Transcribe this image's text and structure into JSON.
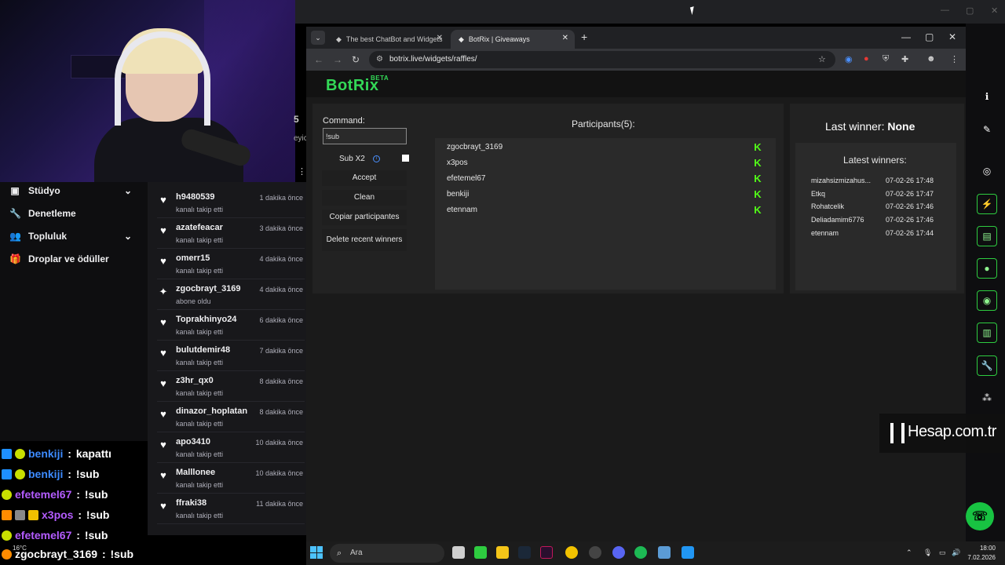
{
  "twitch_nav": {
    "items": [
      {
        "label": "Stüdyo",
        "icon": "studio-icon",
        "has_chevron": true
      },
      {
        "label": "Denetleme",
        "icon": "wrench-icon",
        "has_chevron": false
      },
      {
        "label": "Topluluk",
        "icon": "community-icon",
        "has_chevron": true
      },
      {
        "label": "Droplar ve ödüller",
        "icon": "gift-icon",
        "has_chevron": false
      }
    ]
  },
  "feed": {
    "partial_count": "5",
    "partial_text": "eyic",
    "rows": [
      {
        "name": "h9480539",
        "sub": "kanalı takip etti",
        "time": "1 dakika önce",
        "icon": "heart-icon"
      },
      {
        "name": "azatefeacar",
        "sub": "kanalı takip etti",
        "time": "3 dakika önce",
        "icon": "heart-icon"
      },
      {
        "name": "omerr15",
        "sub": "kanalı takip etti",
        "time": "4 dakika önce",
        "icon": "heart-icon"
      },
      {
        "name": "zgocbrayt_3169",
        "sub": "abone oldu",
        "time": "4 dakika önce",
        "icon": "sparkle-icon"
      },
      {
        "name": "Toprakhinyo24",
        "sub": "kanalı takip etti",
        "time": "6 dakika önce",
        "icon": "heart-icon"
      },
      {
        "name": "bulutdemir48",
        "sub": "kanalı takip etti",
        "time": "7 dakika önce",
        "icon": "heart-icon"
      },
      {
        "name": "z3hr_qx0",
        "sub": "kanalı takip etti",
        "time": "8 dakika önce",
        "icon": "heart-icon"
      },
      {
        "name": "dinazor_hoplatan",
        "sub": "kanalı takip etti",
        "time": "8 dakika önce",
        "icon": "heart-icon"
      },
      {
        "name": "apo3410",
        "sub": "kanalı takip etti",
        "time": "10 dakika önce",
        "icon": "heart-icon"
      },
      {
        "name": "Malllonee",
        "sub": "kanalı takip etti",
        "time": "10 dakika önce",
        "icon": "heart-icon"
      },
      {
        "name": "ffraki38",
        "sub": "kanalı takip etti",
        "time": "11 dakika önce",
        "icon": "heart-icon"
      }
    ]
  },
  "chat": {
    "lines": [
      {
        "user": "benkiji",
        "message": "kapattı",
        "color": "#3d8bff"
      },
      {
        "user": "benkiji",
        "message": "!sub",
        "color": "#3d8bff"
      },
      {
        "user": "efetemel67",
        "message": "!sub",
        "color": "#b45cff"
      },
      {
        "user": "x3pos",
        "message": "!sub",
        "color": "#b45cff"
      },
      {
        "user": "efetemel67",
        "message": "!sub",
        "color": "#b45cff"
      },
      {
        "user": "zgocbrayt_3169",
        "message": "!sub",
        "color": "#ffffff"
      }
    ]
  },
  "browser": {
    "tabs": [
      {
        "title": "The best ChatBot and Widgets",
        "active": false
      },
      {
        "title": "BotRix | Giveaways",
        "active": true
      }
    ],
    "url": "botrix.live/widgets/raffles/"
  },
  "botrix": {
    "logo": "BotRix",
    "beta": "BETA",
    "command_label": "Command:",
    "command_value": "!sub",
    "sub_x2_label": "Sub X2",
    "buttons": [
      "Accept",
      "Clean",
      "Copiar participantes",
      "Delete recent winners"
    ],
    "participants_title": "Participants(5):",
    "participants": [
      "zgocbrayt_3169",
      "x3pos",
      "efetemel67",
      "benkiji",
      "etennam"
    ],
    "last_winner_label": "Last winner:",
    "last_winner_value": "None",
    "latest_winners_title": "Latest winners:",
    "latest_winners": [
      {
        "name": "mizahsizmizahus...",
        "date": "07-02-26 17:48"
      },
      {
        "name": "Etkq",
        "date": "07-02-26 17:47"
      },
      {
        "name": "Rohatcelik",
        "date": "07-02-26 17:46"
      },
      {
        "name": "Deliadamim6776",
        "date": "07-02-26 17:46"
      },
      {
        "name": "etennam",
        "date": "07-02-26 17:44"
      }
    ],
    "accent_color": "#33d957"
  },
  "watermark": "Hesap.com.tr",
  "taskbar": {
    "search_placeholder": "Ara",
    "time": "18:00",
    "date": "7.02.2026",
    "weather": "16°C"
  }
}
